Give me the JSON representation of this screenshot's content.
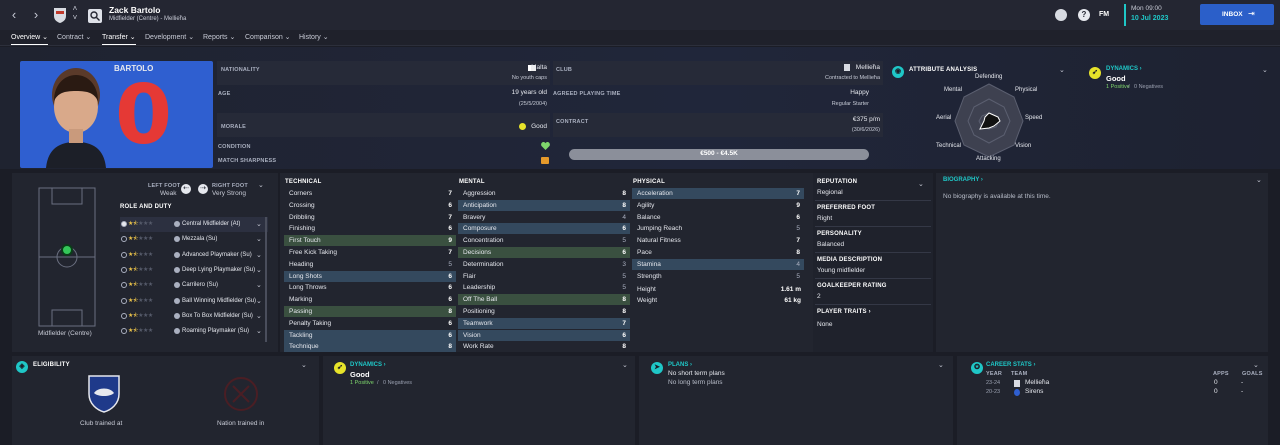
{
  "player": {
    "name": "Zack Bartolo",
    "subtitle": "Midfielder (Centre) - Mellieħa",
    "shirt_name": "BARTOLO",
    "shirt_number": "0"
  },
  "topbar": {
    "datetime_top": "Mon 09:00",
    "datetime_bottom": "10 Jul 2023",
    "inbox_label": "INBOX",
    "fm_label": "FM"
  },
  "tabs": [
    {
      "label": "Overview ⌄"
    },
    {
      "label": "Contract ⌄"
    },
    {
      "label": "Transfer ⌄"
    },
    {
      "label": "Development ⌄"
    },
    {
      "label": "Reports ⌄"
    },
    {
      "label": "Comparison ⌄"
    },
    {
      "label": "History ⌄"
    }
  ],
  "info": {
    "nationality_label": "NATIONALITY",
    "nationality": "Malta",
    "nationality_sub": "No youth caps",
    "age_label": "AGE",
    "age": "19 years old",
    "age_sub": "(25/5/2004)",
    "morale_label": "MORALE",
    "morale": "Good",
    "condition_label": "CONDITION",
    "sharpness_label": "MATCH SHARPNESS",
    "club_label": "CLUB",
    "club": "Mellieħa",
    "club_sub": "Contracted to Mellieħa",
    "apt_label": "AGREED PLAYING TIME",
    "apt": "Happy",
    "apt_sub": "Regular Starter",
    "contract_label": "CONTRACT",
    "contract": "€375 p/m",
    "contract_sub": "(30/6/2026)",
    "value": "€500 - €4.5K"
  },
  "attr_analysis": {
    "title": "ATTRIBUTE ANALYSIS",
    "labels": [
      "Defending",
      "Physical",
      "Speed",
      "Vision",
      "Attacking",
      "Technical",
      "Aerial",
      "Mental"
    ]
  },
  "dynamics_top": {
    "title": "DYNAMICS ›",
    "status": "Good",
    "positives": "1 Positive",
    "sep": "/",
    "negatives": "0 Negatives"
  },
  "pitch": {
    "position_label": "Midfielder (Centre)"
  },
  "feet": {
    "left_label": "LEFT FOOT",
    "left_value": "Weak",
    "right_label": "RIGHT FOOT",
    "right_value": "Very Strong"
  },
  "roles": {
    "title": "ROLE AND DUTY",
    "items": [
      {
        "name": "Central Midfielder (At)",
        "stars": 1.5
      },
      {
        "name": "Mezzala (Su)",
        "stars": 1.5
      },
      {
        "name": "Advanced Playmaker (Su)",
        "stars": 1.5
      },
      {
        "name": "Deep Lying Playmaker (Su)",
        "stars": 1.5
      },
      {
        "name": "Carrilero (Su)",
        "stars": 1.5
      },
      {
        "name": "Ball Winning Midfielder (Su)",
        "stars": 1.5
      },
      {
        "name": "Box To Box Midfielder (Su)",
        "stars": 1.5
      },
      {
        "name": "Roaming Playmaker (Su)",
        "stars": 1.5
      }
    ]
  },
  "technical": {
    "title": "TECHNICAL",
    "items": [
      {
        "name": "Corners",
        "value": "7",
        "hl": ""
      },
      {
        "name": "Crossing",
        "value": "6",
        "hl": ""
      },
      {
        "name": "Dribbling",
        "value": "7",
        "hl": ""
      },
      {
        "name": "Finishing",
        "value": "6",
        "hl": ""
      },
      {
        "name": "First Touch",
        "value": "9",
        "hl": "g"
      },
      {
        "name": "Free Kick Taking",
        "value": "7",
        "hl": ""
      },
      {
        "name": "Heading",
        "value": "5",
        "hl": "d"
      },
      {
        "name": "Long Shots",
        "value": "6",
        "hl": "b"
      },
      {
        "name": "Long Throws",
        "value": "6",
        "hl": ""
      },
      {
        "name": "Marking",
        "value": "6",
        "hl": ""
      },
      {
        "name": "Passing",
        "value": "8",
        "hl": "g"
      },
      {
        "name": "Penalty Taking",
        "value": "6",
        "hl": ""
      },
      {
        "name": "Tackling",
        "value": "6",
        "hl": "b"
      },
      {
        "name": "Technique",
        "value": "8",
        "hl": "b"
      }
    ]
  },
  "mental": {
    "title": "MENTAL",
    "items": [
      {
        "name": "Aggression",
        "value": "8",
        "hl": ""
      },
      {
        "name": "Anticipation",
        "value": "8",
        "hl": "b"
      },
      {
        "name": "Bravery",
        "value": "4",
        "hl": "d"
      },
      {
        "name": "Composure",
        "value": "6",
        "hl": "b"
      },
      {
        "name": "Concentration",
        "value": "5",
        "hl": "d"
      },
      {
        "name": "Decisions",
        "value": "6",
        "hl": "g"
      },
      {
        "name": "Determination",
        "value": "3",
        "hl": "d"
      },
      {
        "name": "Flair",
        "value": "5",
        "hl": "d"
      },
      {
        "name": "Leadership",
        "value": "5",
        "hl": "d"
      },
      {
        "name": "Off The Ball",
        "value": "8",
        "hl": "g"
      },
      {
        "name": "Positioning",
        "value": "8",
        "hl": ""
      },
      {
        "name": "Teamwork",
        "value": "7",
        "hl": "b"
      },
      {
        "name": "Vision",
        "value": "6",
        "hl": "b"
      },
      {
        "name": "Work Rate",
        "value": "8",
        "hl": ""
      }
    ]
  },
  "physical": {
    "title": "PHYSICAL",
    "items": [
      {
        "name": "Acceleration",
        "value": "7",
        "hl": "b"
      },
      {
        "name": "Agility",
        "value": "9",
        "hl": ""
      },
      {
        "name": "Balance",
        "value": "6",
        "hl": ""
      },
      {
        "name": "Jumping Reach",
        "value": "5",
        "hl": "d"
      },
      {
        "name": "Natural Fitness",
        "value": "7",
        "hl": ""
      },
      {
        "name": "Pace",
        "value": "8",
        "hl": ""
      },
      {
        "name": "Stamina",
        "value": "4",
        "hl": "bd"
      },
      {
        "name": "Strength",
        "value": "5",
        "hl": "d"
      }
    ],
    "height_label": "Height",
    "height": "1.61 m",
    "weight_label": "Weight",
    "weight": "61 kg"
  },
  "profile": {
    "reputation_label": "REPUTATION",
    "reputation": "Regional",
    "foot_label": "PREFERRED FOOT",
    "foot": "Right",
    "personality_label": "PERSONALITY",
    "personality": "Balanced",
    "media_label": "MEDIA DESCRIPTION",
    "media": "Young midfielder",
    "gk_label": "GOALKEEPER RATING",
    "gk": "2",
    "traits_label": "PLAYER TRAITS ›",
    "traits": "None"
  },
  "biography": {
    "title": "BIOGRAPHY ›",
    "text": "No biography is available at this time."
  },
  "eligibility": {
    "title": "ELIGIBILITY",
    "club_label": "Club trained at",
    "nation_label": "Nation trained in"
  },
  "dynamics_bottom": {
    "title": "DYNAMICS ›",
    "status": "Good",
    "positives": "1 Positive",
    "sep": "/",
    "negatives": "0 Negatives"
  },
  "plans": {
    "title": "PLANS ›",
    "short": "No short term plans",
    "long": "No long term plans"
  },
  "career": {
    "title": "CAREER STATS ›",
    "col_year": "YEAR",
    "col_team": "TEAM",
    "col_apps": "APPS",
    "col_goals": "GOALS",
    "rows": [
      {
        "year": "23-24",
        "team": "Mellieħa",
        "apps": "0",
        "goals": "-"
      },
      {
        "year": "20-23",
        "team": "Sirens",
        "apps": "0",
        "goals": "-"
      }
    ]
  },
  "colors": {
    "accent": "#2b5fc9",
    "cyan": "#1fc7c7",
    "yellow": "#e7e32a",
    "shirt_blue": "#2f5fd0",
    "shirt_red": "#e53935"
  }
}
